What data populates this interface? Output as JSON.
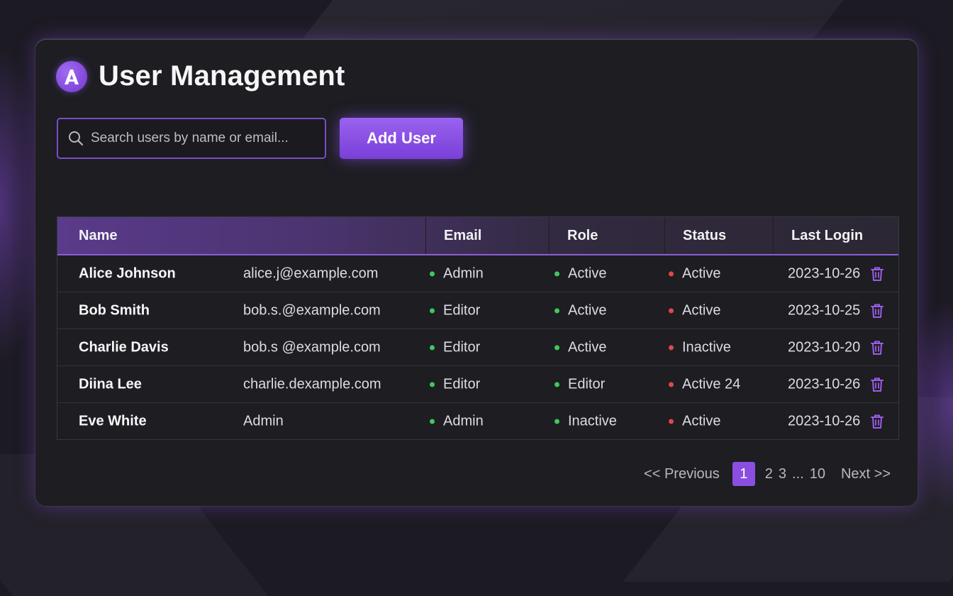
{
  "page": {
    "title": "User Management",
    "logo_letter": "A"
  },
  "search": {
    "placeholder": "Search users by name or email...",
    "value": ""
  },
  "toolbar": {
    "add_label": "Add User"
  },
  "table": {
    "columns": [
      "Name",
      "Email",
      "Role",
      "Status",
      "Last Login"
    ],
    "rows": [
      {
        "name": "Alice Johnson",
        "email": "alice.j@example.com",
        "role": "Admin",
        "state": "Active",
        "status": "Active",
        "last_login": "2023-10-26"
      },
      {
        "name": "Bob Smith",
        "email": "bob.s.@example.com",
        "role": "Editor",
        "state": "Active",
        "status": "Active",
        "last_login": "2023-10-25"
      },
      {
        "name": "Charlie Davis",
        "email": "bob.s @example.com",
        "role": "Editor",
        "state": "Active",
        "status": "Inactive",
        "last_login": "2023-10-20"
      },
      {
        "name": "Diina Lee",
        "email": "charlie.dexample.com",
        "role": "Editor",
        "state": "Editor",
        "status": "Active 24",
        "last_login": "2023-10-26"
      },
      {
        "name": "Eve White",
        "email": "Admin",
        "role": "Admin",
        "state": "Inactive",
        "status": "Active",
        "last_login": "2023-10-26"
      }
    ]
  },
  "pagination": {
    "prev": "<< Previous",
    "current": "1",
    "pages": [
      "2",
      "3"
    ],
    "ellipsis": "...",
    "last": "10",
    "next": "Next >>"
  },
  "colors": {
    "accent": "#8a4fe0",
    "card_bg": "#1d1d22",
    "page_bg": "#1c1a22",
    "dot_green": "#3ec95a",
    "dot_red": "#e04848"
  },
  "icons": {
    "logo": "a-logo-icon",
    "search": "search-icon",
    "delete": "trash-icon"
  }
}
